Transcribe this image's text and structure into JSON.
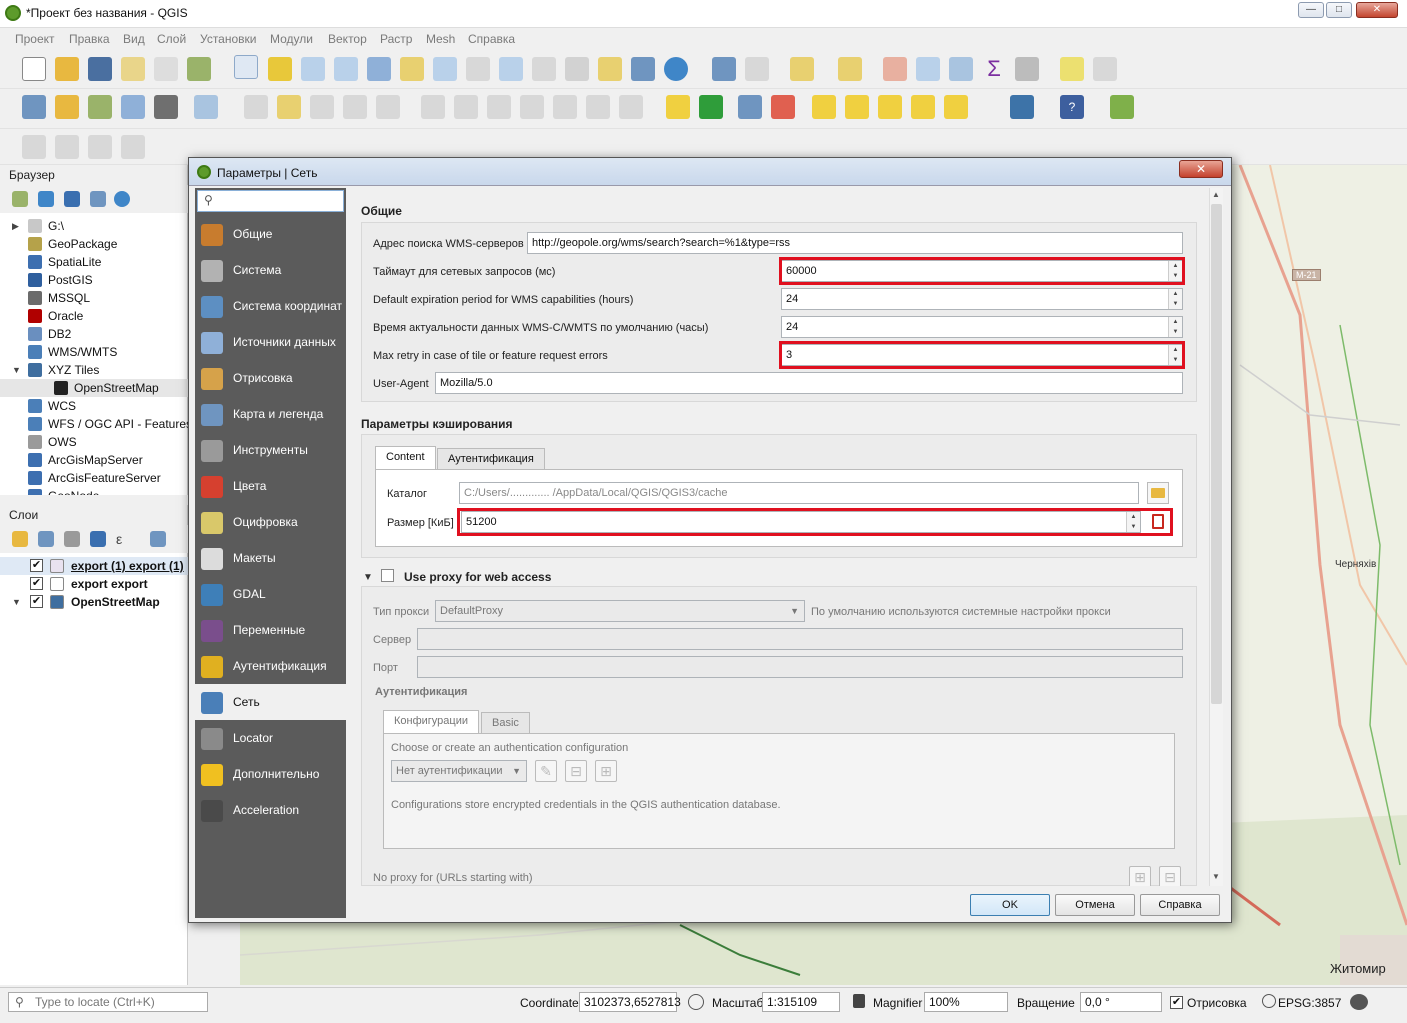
{
  "window": {
    "title": "*Проект без названия - QGIS"
  },
  "menu": [
    "Проект",
    "Правка",
    "Вид",
    "Слой",
    "Установки",
    "Модули",
    "Вектор",
    "Растр",
    "Mesh",
    "Справка"
  ],
  "browser": {
    "title": "Браузер",
    "items": [
      {
        "label": "G:\\",
        "color": "#c8c8c8"
      },
      {
        "label": "GeoPackage",
        "color": "#b5a24a"
      },
      {
        "label": "SpatiaLite",
        "color": "#3d6fb0"
      },
      {
        "label": "PostGIS",
        "color": "#2f5f9e"
      },
      {
        "label": "MSSQL",
        "color": "#6b6b6b"
      },
      {
        "label": "Oracle",
        "color": "#b00000"
      },
      {
        "label": "DB2",
        "color": "#6a8fbf"
      },
      {
        "label": "WMS/WMTS",
        "color": "#4b7fb8"
      },
      {
        "label": "XYZ Tiles",
        "color": "#3f6e9f"
      },
      {
        "label": "OpenStreetMap",
        "color": "#222"
      },
      {
        "label": "WCS",
        "color": "#4b7fb8"
      },
      {
        "label": "WFS / OGC API - Features",
        "color": "#4b7fb8"
      },
      {
        "label": "OWS",
        "color": "#9a9a9a"
      },
      {
        "label": "ArcGisMapServer",
        "color": "#3d6fb0"
      },
      {
        "label": "ArcGisFeatureServer",
        "color": "#3d6fb0"
      },
      {
        "label": "GeoNode",
        "color": "#3d6fb0"
      }
    ]
  },
  "layers": {
    "title": "Слои",
    "items": [
      {
        "label": "export (1) export (1)",
        "checked": "✔"
      },
      {
        "label": "export export",
        "checked": "✔"
      },
      {
        "label": "OpenStreetMap",
        "checked": "✔"
      }
    ]
  },
  "map_labels": {
    "road": "М-21",
    "town1": "Черняхів",
    "city": "Житомир"
  },
  "status": {
    "locate_placeholder": "Type to locate (Ctrl+K)",
    "coordinate_label": "Coordinate",
    "coordinate_value": "3102373,6527813",
    "scale_label": "Масштаб",
    "scale_value": "1:315109",
    "magnifier_label": "Magnifier",
    "magnifier_value": "100%",
    "rotation_label": "Вращение",
    "rotation_value": "0,0 °",
    "render_label": "Отрисовка",
    "crs": "EPSG:3857"
  },
  "dialog": {
    "title": "Параметры | Сеть",
    "nav": [
      {
        "label": "Общие",
        "color": "#c87c2e"
      },
      {
        "label": "Система",
        "color": "#b2b2b2"
      },
      {
        "label": "Система координат",
        "color": "#5d8fc2"
      },
      {
        "label": "Источники данных",
        "color": "#8fb0d8"
      },
      {
        "label": "Отрисовка",
        "color": "#d6a24a"
      },
      {
        "label": "Карта и легенда",
        "color": "#6f95c0"
      },
      {
        "label": "Инструменты",
        "color": "#9a9a9a"
      },
      {
        "label": "Цвета",
        "color": "#d6402f"
      },
      {
        "label": "Оцифровка",
        "color": "#d9c86a"
      },
      {
        "label": "Макеты",
        "color": "#dcdcdc"
      },
      {
        "label": "GDAL",
        "color": "#3e7fb8"
      },
      {
        "label": "Переменные",
        "color": "#7a4e8c"
      },
      {
        "label": "Аутентификация",
        "color": "#e0b020"
      },
      {
        "label": "Сеть",
        "color": "#4a7fb8"
      },
      {
        "label": "Locator",
        "color": "#8a8a8a"
      },
      {
        "label": "Дополнительно",
        "color": "#f0c020"
      },
      {
        "label": "Acceleration",
        "color": "#4a4a4a"
      }
    ],
    "general": {
      "header": "Общие",
      "wms_search_label": "Адрес поиска WMS-серверов",
      "wms_search_value": "http://geopole.org/wms/search?search=%1&type=rss",
      "timeout_label": "Таймаут для сетевых запросов (мс)",
      "timeout_value": "60000",
      "expiration_label": "Default expiration period for WMS capabilities (hours)",
      "expiration_value": "24",
      "wmts_label": "Время актуальности данных WMS-C/WMTS по умолчанию (часы)",
      "wmts_value": "24",
      "retry_label": "Max retry in case of tile or feature request errors",
      "retry_value": "3",
      "useragent_label": "User-Agent",
      "useragent_value": "Mozilla/5.0"
    },
    "cache": {
      "header": "Параметры кэширования",
      "tabs": [
        "Content",
        "Аутентификация"
      ],
      "dir_label": "Каталог",
      "dir_value": "C:/Users/............. /AppData/Local/QGIS/QGIS3/cache",
      "size_label": "Размер [КиБ]",
      "size_value": "51200"
    },
    "proxy": {
      "header": "Use proxy for web access",
      "type_label": "Тип прокси",
      "type_value": "DefaultProxy",
      "type_hint": "По умолчанию используются системные настройки прокси",
      "server_label": "Сервер",
      "port_label": "Порт",
      "auth_header": "Аутентификация",
      "auth_tabs": [
        "Конфигурации",
        "Basic"
      ],
      "auth_prompt": "Choose or create an authentication configuration",
      "auth_select": "Нет аутентификации",
      "auth_note": "Configurations store encrypted credentials in the QGIS authentication database.",
      "noproxy_label": "No proxy for (URLs starting with)"
    },
    "buttons": {
      "ok": "OK",
      "cancel": "Отмена",
      "help": "Справка"
    }
  }
}
